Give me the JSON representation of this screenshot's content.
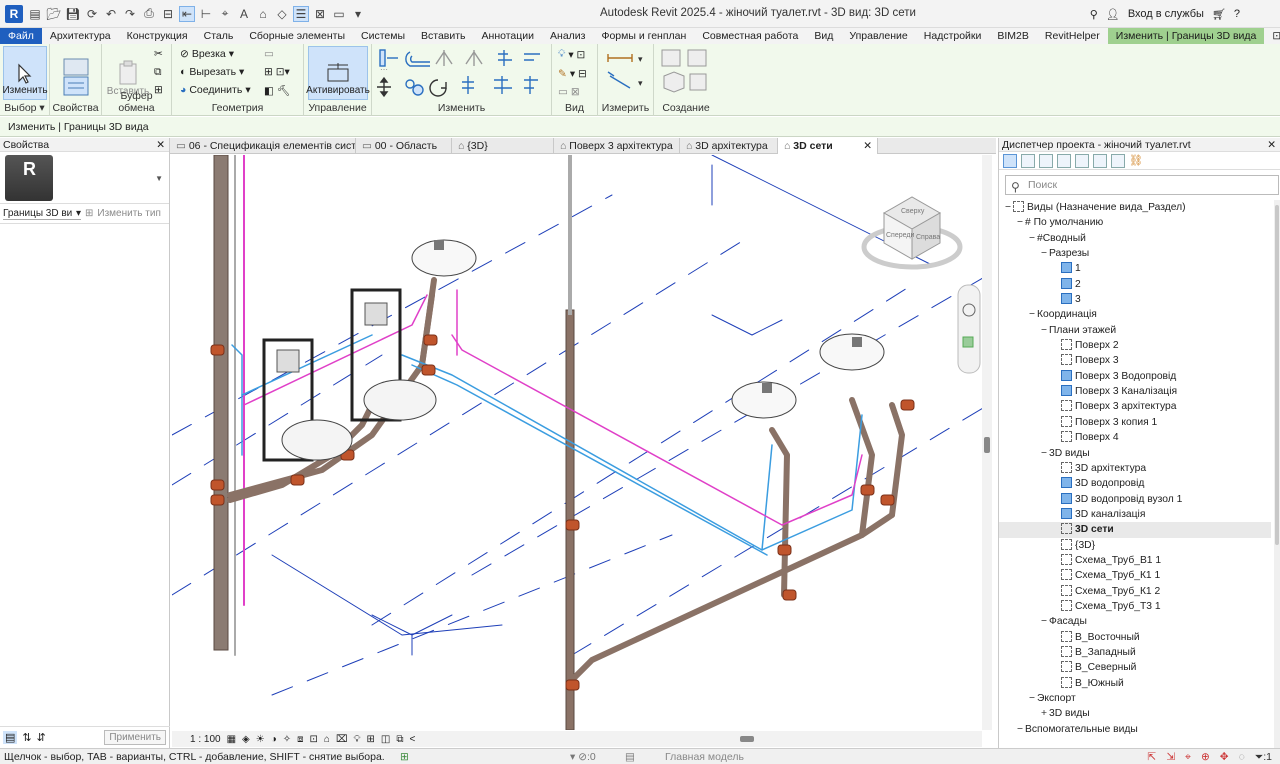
{
  "app": {
    "title": "Autodesk Revit 2025.4 - жіночий туалет.rvt - 3D вид: 3D сети",
    "logo_letter": "R",
    "login": "Вход в службы",
    "qat_icons": [
      "open-icon",
      "save-icon",
      "sync-icon",
      "undo-icon",
      "redo-icon",
      "print-icon",
      "measure-icon",
      "align-icon",
      "text-icon",
      "home-icon",
      "switch-windows-icon",
      "close-hidden-icon"
    ]
  },
  "menu": {
    "tabs": [
      "Файл",
      "Архитектура",
      "Конструкция",
      "Сталь",
      "Сборные элементы",
      "Системы",
      "Вставить",
      "Аннотации",
      "Анализ",
      "Формы и генплан",
      "Совместная работа",
      "Вид",
      "Управление",
      "Надстройки",
      "BIM2B",
      "RevitHelper",
      "Изменить | Границы 3D вида"
    ]
  },
  "ribbon": {
    "groups": {
      "select": "Выбор",
      "properties": "Свойства",
      "clipboard": "Буфер обмена",
      "geometry": "Геометрия",
      "manage": "Управление",
      "modify": "Изменить",
      "view": "Вид",
      "measure": "Измерить",
      "create": "Создание"
    },
    "modify_button": "Изменить",
    "paste_button": "Вставить",
    "cut_label": "Врезка",
    "cutout_label": "Вырезать",
    "join_label": "Соединить",
    "activate_button": "Активировать"
  },
  "options_bar": "Изменить | Границы 3D вида",
  "properties": {
    "title": "Свойства",
    "type_letter": "R",
    "filter_value": "Границы 3D ви",
    "edit_type": "Изменить тип",
    "apply": "Применить"
  },
  "view_tabs": [
    {
      "label": "06 - Спецификація елементів сист..."
    },
    {
      "label": "00 - Область"
    },
    {
      "label": "{3D}"
    },
    {
      "label": "Поверх 3 архітектура"
    },
    {
      "label": "3D архітектура"
    },
    {
      "label": "3D сети"
    }
  ],
  "viewcube": {
    "top": "Сверху",
    "front": "Спереди",
    "right": "Справа"
  },
  "view_control": {
    "scale": "1 : 100"
  },
  "browser": {
    "title": "Диспетчер проекта - жіночий туалет.rvt",
    "search_placeholder": "Поиск",
    "tree": [
      {
        "indent": 0,
        "toggle": "−",
        "icon": "views",
        "label": "Виды (Назначение вида_Раздел)"
      },
      {
        "indent": 1,
        "toggle": "−",
        "label": "# По умолчанию"
      },
      {
        "indent": 2,
        "toggle": "−",
        "label": "#Сводный"
      },
      {
        "indent": 3,
        "toggle": "−",
        "label": "Разрезы"
      },
      {
        "indent": 4,
        "icon": "blue",
        "label": "1"
      },
      {
        "indent": 4,
        "icon": "blue",
        "label": "2"
      },
      {
        "indent": 4,
        "icon": "blue",
        "label": "3"
      },
      {
        "indent": 2,
        "toggle": "−",
        "label": "Координація"
      },
      {
        "indent": 3,
        "toggle": "−",
        "label": "Плани этажей"
      },
      {
        "indent": 4,
        "icon": "dash",
        "label": "Поверх 2"
      },
      {
        "indent": 4,
        "icon": "dash",
        "label": "Поверх 3"
      },
      {
        "indent": 4,
        "icon": "blue",
        "label": "Поверх 3 Водопровід"
      },
      {
        "indent": 4,
        "icon": "blue",
        "label": "Поверх 3 Каналізація"
      },
      {
        "indent": 4,
        "icon": "dash",
        "label": "Поверх 3 архітектура"
      },
      {
        "indent": 4,
        "icon": "dash",
        "label": "Поверх 3 копия 1"
      },
      {
        "indent": 4,
        "icon": "dash",
        "label": "Поверх 4"
      },
      {
        "indent": 3,
        "toggle": "−",
        "label": "3D виды"
      },
      {
        "indent": 4,
        "icon": "dash",
        "label": "3D архітектура"
      },
      {
        "indent": 4,
        "icon": "blue",
        "label": "3D водопровід"
      },
      {
        "indent": 4,
        "icon": "blue",
        "label": "3D водопровід вузол 1"
      },
      {
        "indent": 4,
        "icon": "blue",
        "label": "3D каналізація"
      },
      {
        "indent": 4,
        "icon": "dash",
        "label": "3D сети",
        "current": true
      },
      {
        "indent": 4,
        "icon": "dash",
        "label": "{3D}"
      },
      {
        "indent": 4,
        "icon": "dash",
        "label": "Схема_Труб_В1 1"
      },
      {
        "indent": 4,
        "icon": "dash",
        "label": "Схема_Труб_К1 1"
      },
      {
        "indent": 4,
        "icon": "dash",
        "label": "Схема_Труб_К1 2"
      },
      {
        "indent": 4,
        "icon": "dash",
        "label": "Схема_Труб_Т3 1"
      },
      {
        "indent": 3,
        "toggle": "−",
        "label": "Фасады"
      },
      {
        "indent": 4,
        "icon": "dash",
        "label": "В_Восточный"
      },
      {
        "indent": 4,
        "icon": "dash",
        "label": "В_Западный"
      },
      {
        "indent": 4,
        "icon": "dash",
        "label": "В_Северный"
      },
      {
        "indent": 4,
        "icon": "dash",
        "label": "В_Южный"
      },
      {
        "indent": 2,
        "toggle": "−",
        "label": "Экспорт"
      },
      {
        "indent": 3,
        "toggle": "+",
        "label": "3D виды"
      },
      {
        "indent": 1,
        "toggle": "−",
        "label": "Вспомогательные виды"
      }
    ]
  },
  "status": {
    "message": "Щелчок - выбор, TAB - варианты, CTRL - добавление, SHIFT - снятие выбора.",
    "coord": ":0",
    "model": "Главная модель",
    "filter_count": ":1"
  },
  "colors": {
    "accent": "#1f5fbf",
    "context_tab": "#9fd08f",
    "ribbon_bg": "#f1f9ec",
    "pipe_brown": "#8a7266",
    "pipe_orange": "#c0552c",
    "pipe_blue": "#3b9de0",
    "pipe_magenta": "#e040c8",
    "grid_blue": "#1e3fb8"
  }
}
